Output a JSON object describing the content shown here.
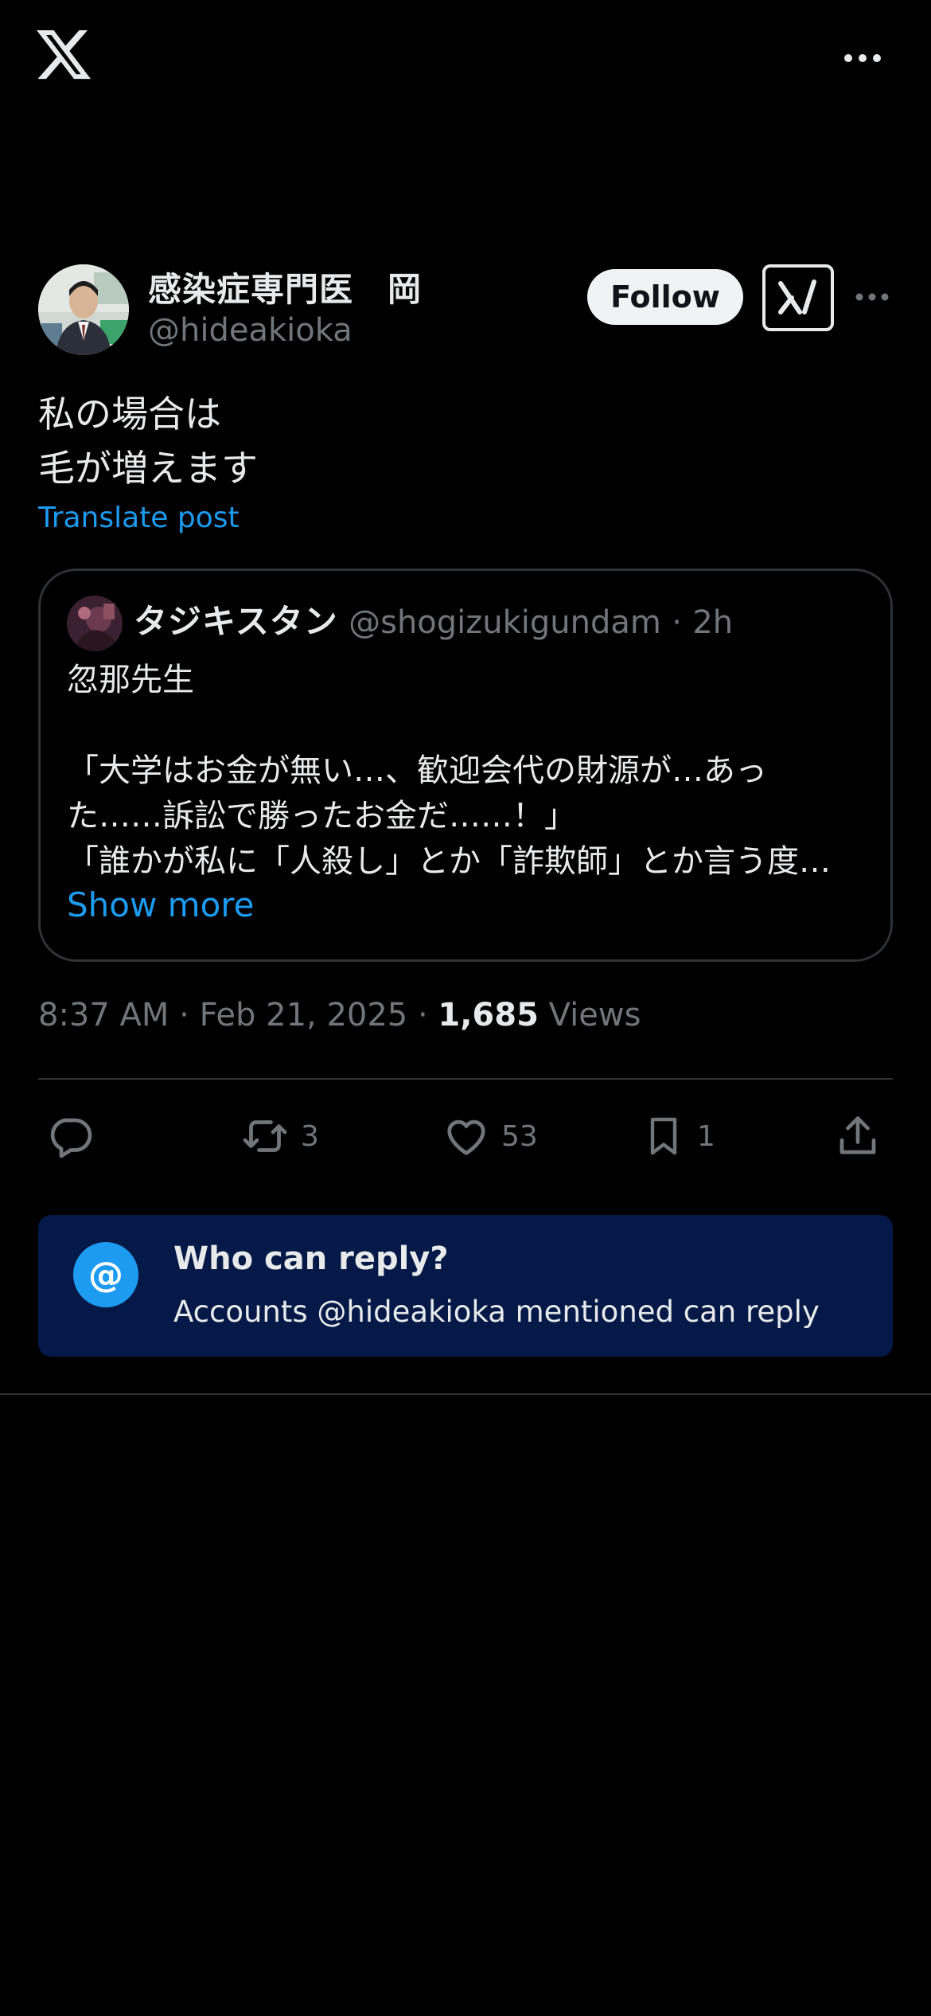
{
  "topbar": {
    "logo_icon": "x-logo-icon",
    "more_icon": "more-horizontal-icon"
  },
  "author": {
    "display_name": "感染症専門医　岡",
    "handle": "@hideakioka",
    "avatar_icon": "avatar-photo",
    "follow_label": "Follow",
    "grok_icon": "grok-icon",
    "more_icon": "more-horizontal-icon"
  },
  "post": {
    "lines": [
      "私の場合は",
      "毛が増えます"
    ],
    "translate_label": "Translate post"
  },
  "quote": {
    "display_name": "タジキスタン",
    "handle": "@shogizukigundam",
    "separator": "·",
    "time": "2h",
    "line1": "忽那先生",
    "line2": "「大学はお金が無い…、歓迎会代の財源が…あっ",
    "line3": "た……訴訟で勝ったお金だ……！」",
    "line4": "「誰かが私に「人殺し」とか「詐欺師」とか言う度…",
    "show_more_label": "Show more"
  },
  "meta": {
    "time": "8:37 AM",
    "date": "Feb 21, 2025",
    "separator": "·",
    "views_count": "1,685",
    "views_label": "Views"
  },
  "actions": {
    "reply_icon": "reply-icon",
    "retweet_icon": "retweet-icon",
    "retweet_count": "3",
    "like_icon": "heart-icon",
    "like_count": "53",
    "bookmark_icon": "bookmark-icon",
    "bookmark_count": "1",
    "share_icon": "share-icon"
  },
  "who_can_reply": {
    "icon": "at-icon",
    "at_symbol": "@",
    "title": "Who can reply?",
    "description": "Accounts @hideakioka mentioned can reply"
  },
  "colors": {
    "background": "#000000",
    "text_primary": "#e7e9ea",
    "text_secondary": "#71767b",
    "accent": "#1d9bf0",
    "border": "#2f3336",
    "reply_box_bg": "#041947"
  }
}
